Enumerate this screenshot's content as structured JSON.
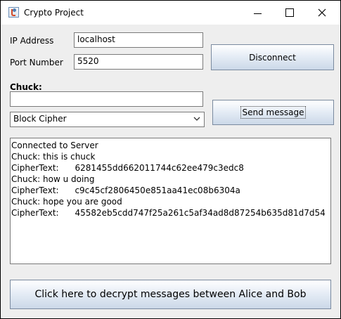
{
  "window": {
    "title": "Crypto Project",
    "icon": "java-cup-icon"
  },
  "form": {
    "ip_label": "IP Address",
    "ip_value": "localhost",
    "port_label": "Port Number",
    "port_value": "5520",
    "disconnect_label": "Disconnect",
    "user_label": "Chuck:",
    "message_value": "",
    "cipher_selected": "Block Cipher",
    "send_label": "Send message"
  },
  "log": {
    "lines": [
      "Connected to Server",
      "Chuck: this is chuck",
      "CipherText:      6281455dd662011744c62ee479c3edc8",
      "Chuck: how u doing",
      "CipherText:      c9c45cf2806450e851aa41ec08b6304a",
      "Chuck: hope you are good",
      "CipherText:      45582eb5cdd747f25a261c5af34ad8d87254b635d81d7d54"
    ]
  },
  "footer": {
    "decrypt_label": "Click here to decrypt messages between Alice and Bob"
  }
}
